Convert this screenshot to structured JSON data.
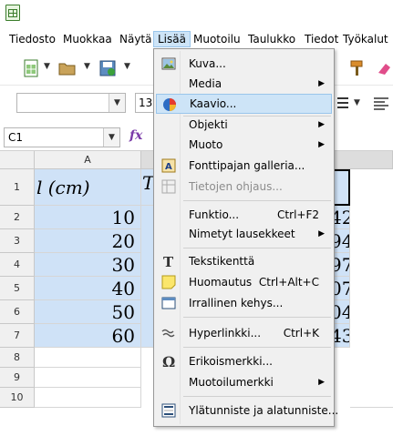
{
  "menubar": {
    "items": [
      "Tiedosto",
      "Muokkaa",
      "Näytä",
      "Lisää",
      "Muotoilu",
      "Taulukko",
      "Tiedot",
      "Työkalut"
    ],
    "active": "Lisää"
  },
  "toolbar": {
    "font_size_value": "13,"
  },
  "formula_bar": {
    "cell_reference": "C1",
    "fx_label": "fx"
  },
  "sheet": {
    "columns": [
      "A"
    ],
    "rows": [
      "1",
      "2",
      "3",
      "4",
      "5",
      "6",
      "7",
      "8",
      "9",
      "10"
    ],
    "header_row": {
      "a1": "l (cm)",
      "b1_partial": "T"
    },
    "column_a_values": [
      "10",
      "20",
      "30",
      "40",
      "50",
      "60"
    ],
    "column_c_partial_values": [
      "42",
      "94",
      "97",
      "07",
      "04",
      "43"
    ]
  },
  "insert_menu": {
    "items": [
      {
        "label": "Kuva...",
        "shortcut": "",
        "submenu": false,
        "disabled": false,
        "icon": "image-icon"
      },
      {
        "label": "Media",
        "shortcut": "",
        "submenu": true,
        "disabled": false,
        "icon": ""
      },
      {
        "label": "Kaavio...",
        "shortcut": "",
        "submenu": false,
        "disabled": false,
        "icon": "chart-icon"
      },
      {
        "label": "Objekti",
        "shortcut": "",
        "submenu": true,
        "disabled": false,
        "icon": ""
      },
      {
        "label": "Muoto",
        "shortcut": "",
        "submenu": true,
        "disabled": false,
        "icon": ""
      },
      {
        "label": "Fonttipajan galleria...",
        "shortcut": "",
        "submenu": false,
        "disabled": false,
        "icon": "fontwork-icon"
      },
      {
        "label": "Tietojen ohjaus...",
        "shortcut": "",
        "submenu": false,
        "disabled": true,
        "icon": "pivot-table-icon"
      },
      {
        "label": "Funktio...",
        "shortcut": "Ctrl+F2",
        "submenu": false,
        "disabled": false,
        "icon": ""
      },
      {
        "label": "Nimetyt lausekkeet",
        "shortcut": "",
        "submenu": true,
        "disabled": false,
        "icon": ""
      },
      {
        "label": "Tekstikenttä",
        "shortcut": "",
        "submenu": false,
        "disabled": false,
        "icon": "text-box-icon"
      },
      {
        "label": "Huomautus",
        "shortcut": "Ctrl+Alt+C",
        "submenu": false,
        "disabled": false,
        "icon": "comment-icon"
      },
      {
        "label": "Irrallinen kehys...",
        "shortcut": "",
        "submenu": false,
        "disabled": false,
        "icon": "frame-icon"
      },
      {
        "label": "Hyperlinkki...",
        "shortcut": "Ctrl+K",
        "submenu": false,
        "disabled": false,
        "icon": "hyperlink-icon"
      },
      {
        "label": "Erikoismerkki...",
        "shortcut": "",
        "submenu": false,
        "disabled": false,
        "icon": "omega-icon"
      },
      {
        "label": "Muotoilumerkki",
        "shortcut": "",
        "submenu": true,
        "disabled": false,
        "icon": ""
      },
      {
        "label": "Ylätunniste ja alatunniste...",
        "shortcut": "",
        "submenu": false,
        "disabled": false,
        "icon": "header-footer-icon"
      }
    ],
    "hovered": "Kaavio..."
  },
  "colors": {
    "selection_blue": "#cfe2f7",
    "menu_hover": "#cde4f7",
    "menu_bg": "#f0f0f0"
  }
}
